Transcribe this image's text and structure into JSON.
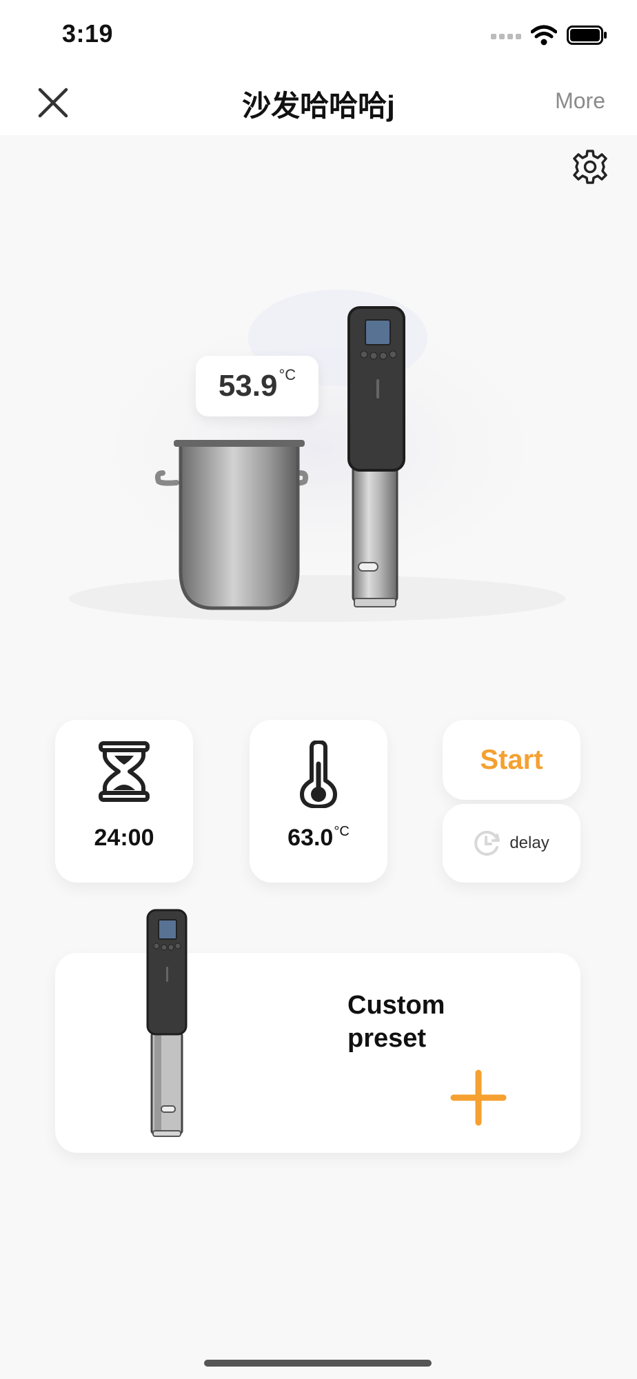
{
  "status_bar": {
    "time": "3:19"
  },
  "nav": {
    "title": "沙发哈哈哈j",
    "more_label": "More"
  },
  "device": {
    "current_temp": "53.9",
    "temp_unit": "°C"
  },
  "controls": {
    "timer_value": "24:00",
    "target_temp": "63.0",
    "target_unit": "°C",
    "start_label": "Start",
    "delay_label": "delay"
  },
  "preset": {
    "label_line1": "Custom",
    "label_line2": "preset"
  },
  "colors": {
    "accent": "#f5a030",
    "background": "#f8f8f8",
    "card": "#ffffff"
  }
}
